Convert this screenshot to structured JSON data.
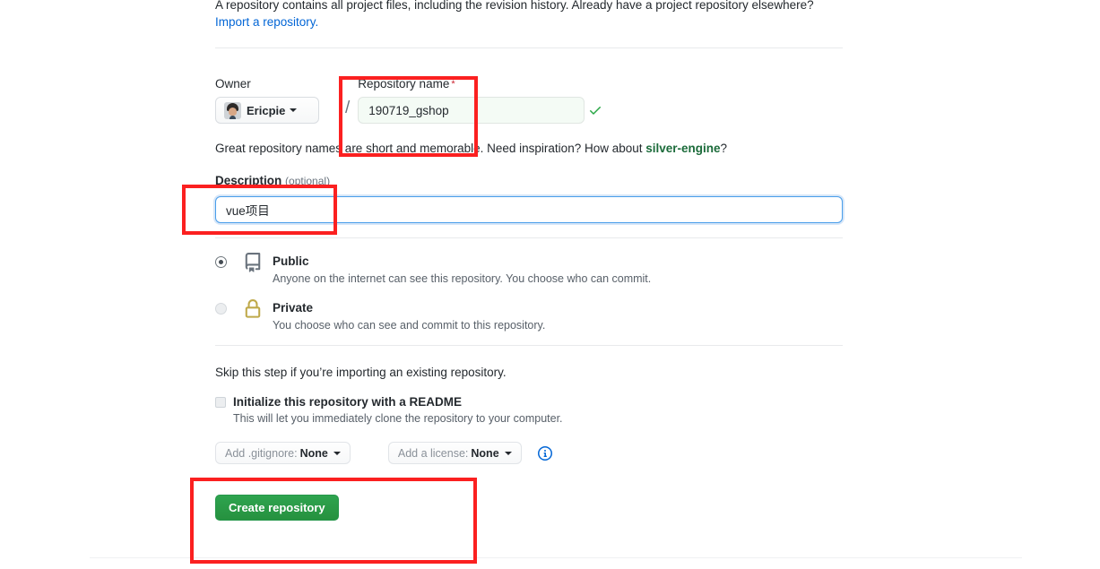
{
  "intro": {
    "line1": "A repository contains all project files, including the revision history. Already have a project repository elsewhere?",
    "import_link": "Import a repository."
  },
  "owner": {
    "label": "Owner",
    "name": "Ericpie",
    "avatar_icon": "user-avatar"
  },
  "separator": "/",
  "repository": {
    "label": "Repository name",
    "required_mark": "*",
    "value": "190719_gshop",
    "placeholder": "",
    "valid_icon": "check-icon"
  },
  "hint": {
    "before": "Great repository names are short and memorable. Need inspiration? How about ",
    "suggestion": "silver-engine",
    "after": "?"
  },
  "description": {
    "label": "Description",
    "optional": "(optional)",
    "value": "vue项目",
    "placeholder": ""
  },
  "visibility": {
    "options": [
      {
        "id": "public",
        "title": "Public",
        "description": "Anyone on the internet can see this repository. You choose who can commit.",
        "icon": "book-icon",
        "selected": true
      },
      {
        "id": "private",
        "title": "Private",
        "description": "You choose who can see and commit to this repository.",
        "icon": "lock-icon",
        "selected": false
      }
    ]
  },
  "initialize": {
    "skip_text": "Skip this step if you’re importing an existing repository.",
    "readme_label": "Initialize this repository with a README",
    "readme_description": "This will let you immediately clone the repository to your computer.",
    "readme_checked": false
  },
  "selects": {
    "gitignore": {
      "prefix": "Add .gitignore:",
      "value": "None",
      "caret_icon": "chevron-down-icon"
    },
    "license": {
      "prefix": "Add a license:",
      "value": "None",
      "caret_icon": "chevron-down-icon"
    },
    "info_icon": "info-icon"
  },
  "submit": {
    "label": "Create repository"
  },
  "colors": {
    "accent_green": "#2ea44f",
    "link_blue": "#0366d6",
    "suggestion_green": "#1b6b3a",
    "annotation_red": "#fb2020",
    "lock_gold": "#bfa94a",
    "focus_blue": "#4a9eea"
  },
  "annotations": [
    {
      "name": "repository-name-highlight"
    },
    {
      "name": "description-highlight"
    },
    {
      "name": "create-repository-highlight"
    }
  ]
}
